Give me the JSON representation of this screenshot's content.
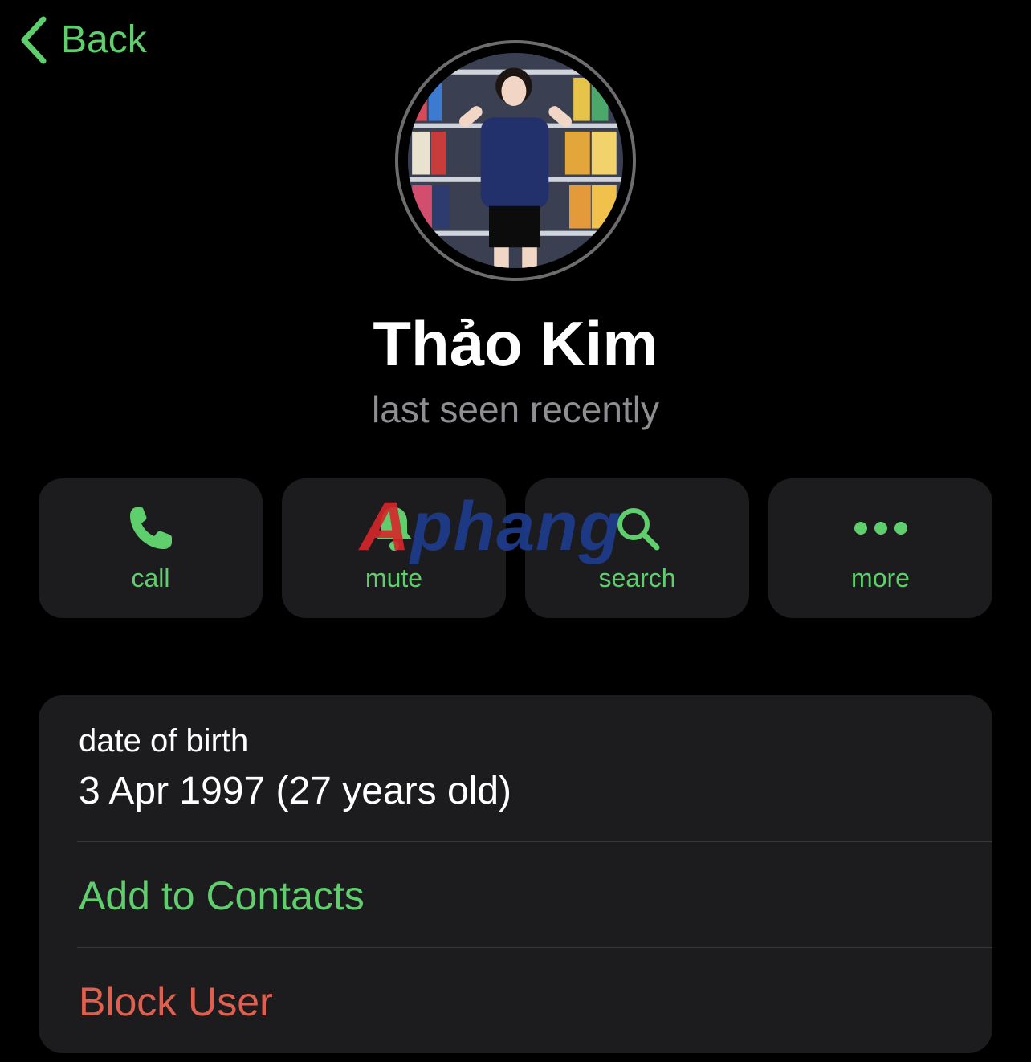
{
  "nav": {
    "back_label": "Back",
    "back_icon": "chevron-left-icon"
  },
  "profile": {
    "name": "Thảo Kim",
    "status": "last seen recently",
    "avatar": "avatar-photo"
  },
  "actions": [
    {
      "label": "call",
      "icon": "phone-icon"
    },
    {
      "label": "mute",
      "icon": "bell-icon"
    },
    {
      "label": "search",
      "icon": "search-icon"
    },
    {
      "label": "more",
      "icon": "ellipsis-icon"
    }
  ],
  "watermark": {
    "first": "A",
    "rest": "phang"
  },
  "info": {
    "dob_label": "date of birth",
    "dob_value": "3 Apr 1997 (27 years old)",
    "add_contact": "Add to Contacts",
    "block_user": "Block User"
  },
  "colors": {
    "accent": "#5fcf6d",
    "destructive": "#e0604f",
    "card": "#1c1c1e",
    "secondary_text": "#8e8e93"
  }
}
